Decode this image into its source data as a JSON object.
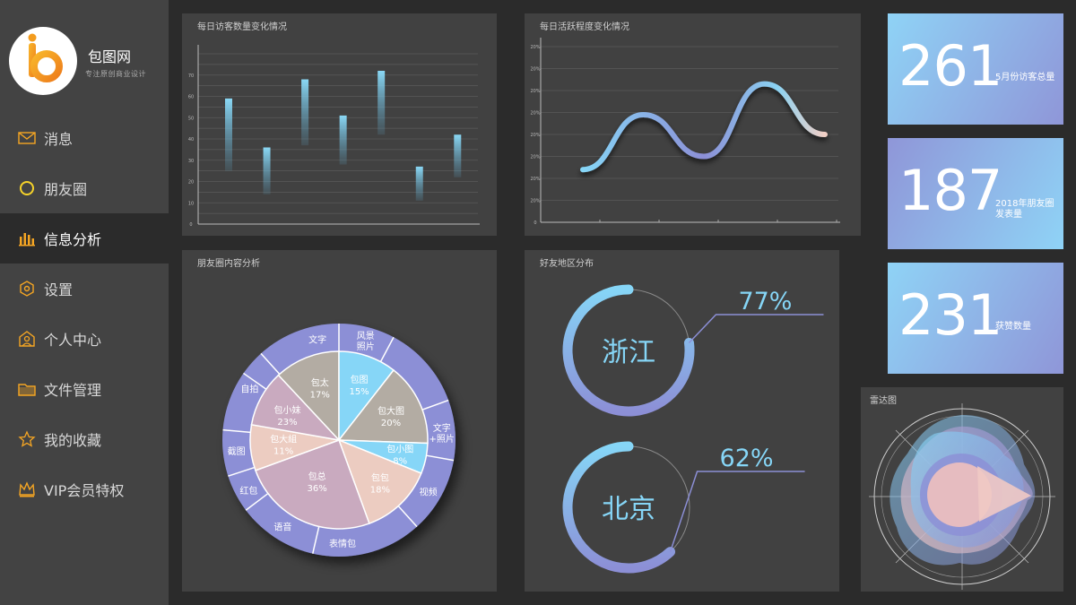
{
  "brand": {
    "name": "包图网",
    "subtitle": "专注原创商业设计"
  },
  "colors": {
    "accent": "#f6a623",
    "sidebar": "#434343",
    "panel": "#414141",
    "background": "#2b2b2b",
    "lavender": "#8c8fd6",
    "cyan": "#86d6f7"
  },
  "menu": [
    {
      "label": "消息",
      "icon": "mail-icon"
    },
    {
      "label": "朋友圈",
      "icon": "circle-icon"
    },
    {
      "label": "信息分析",
      "icon": "bar-chart-icon",
      "active": true
    },
    {
      "label": "设置",
      "icon": "gear-icon"
    },
    {
      "label": "个人中心",
      "icon": "user-icon"
    },
    {
      "label": "文件管理",
      "icon": "folder-icon"
    },
    {
      "label": "我的收藏",
      "icon": "star-icon"
    },
    {
      "label": "VIP会员特权",
      "icon": "crown-icon"
    }
  ],
  "panels": {
    "visitors": {
      "title": "每日访客数量变化情况"
    },
    "activity": {
      "title": "每日活跃程度变化情况"
    },
    "content": {
      "title": "朋友圈内容分析"
    },
    "region": {
      "title": "好友地区分布"
    },
    "radar": {
      "title": "雷达图"
    }
  },
  "stats": [
    {
      "value": "261",
      "label1": "5月份访客总量",
      "label2": ""
    },
    {
      "value": "187",
      "label1": "2018年朋友圈",
      "label2": "发表量"
    },
    {
      "value": "231",
      "label1": "获赞数量",
      "label2": ""
    }
  ],
  "chart_data": [
    {
      "type": "bar",
      "title": "每日访客数量变化情况",
      "yticks": [
        "0",
        "10",
        "20",
        "30",
        "40",
        "50",
        "60",
        "70"
      ],
      "ylim": [
        0,
        80
      ],
      "series": [
        {
          "low": [
            25,
            14,
            37,
            28,
            42,
            11,
            22
          ],
          "high": [
            59,
            36,
            68,
            51,
            72,
            27,
            42
          ]
        }
      ],
      "grid": true
    },
    {
      "type": "line",
      "title": "每日活跃程度变化情况",
      "yticks": [
        "0",
        "20%",
        "20%",
        "20%",
        "20%",
        "20%",
        "20%",
        "20%",
        "20%"
      ],
      "x": [
        0,
        1,
        2,
        3,
        4,
        5
      ],
      "values": [
        2.4,
        4.9,
        3.0,
        6.3,
        4.0
      ],
      "grid": true
    },
    {
      "type": "pie",
      "title": "朋友圈内容分析",
      "inner": [
        {
          "label": "包太",
          "value": "17%"
        },
        {
          "label": "包图",
          "value": "15%"
        },
        {
          "label": "包大图",
          "value": "20%"
        },
        {
          "label": "包小图",
          "value": "8%"
        },
        {
          "label": "包包",
          "value": "18%"
        },
        {
          "label": "包总",
          "value": "36%"
        },
        {
          "label": "包大組",
          "value": "11%"
        },
        {
          "label": "包小妹",
          "value": "23%"
        }
      ],
      "outer": [
        "文字",
        "风景照片",
        "文字+照片",
        "视频",
        "表情包",
        "语音",
        "红包",
        "截图",
        "自拍"
      ]
    },
    {
      "type": "pie",
      "title": "好友地区分布",
      "slices": [
        {
          "label": "浙江",
          "value": "77%"
        },
        {
          "label": "北京",
          "value": "62%"
        }
      ]
    }
  ]
}
